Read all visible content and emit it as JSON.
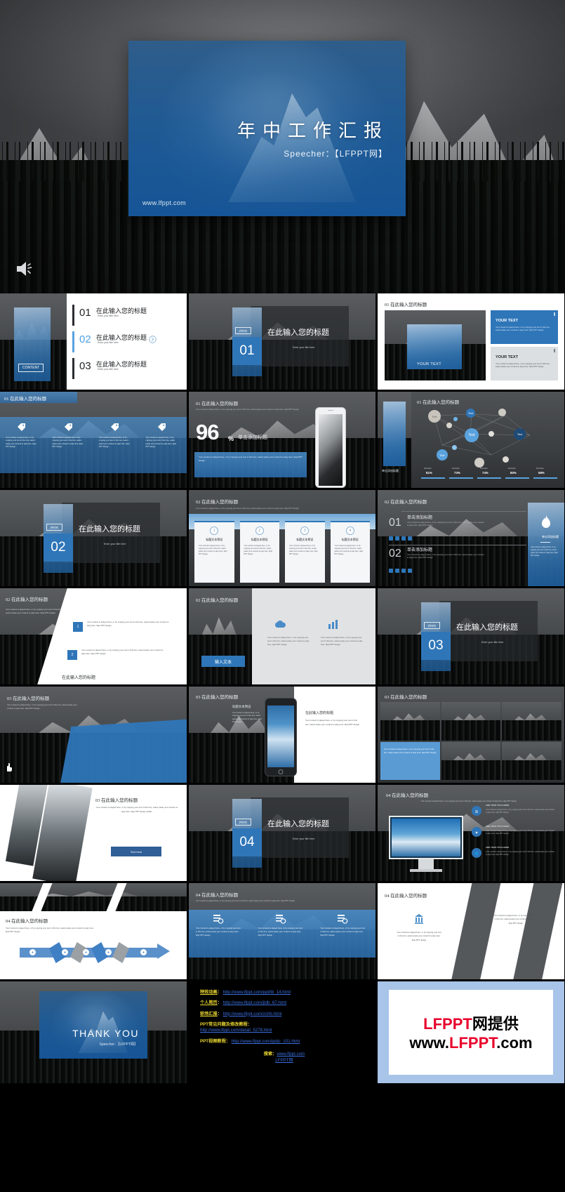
{
  "hero": {
    "title": "年中工作汇报",
    "speaker_label": "Speecher：",
    "speaker_value": "【LFPPT网】",
    "url": "www.lfppt.com",
    "sound_icon": "speaker-icon"
  },
  "common": {
    "title_cn": "在此输入您的标题",
    "subtitle_en": "Enter your title here",
    "body_en": "Your content is played here, or by copying your text in this box, select paste your content to play here. lfppt PPT design studio.",
    "body_en_short": "Your content is played here, or by copying your text in this box, select paste your content to play here. lfppt PPT design",
    "your_text": "YOUR TEXT",
    "text": "Text",
    "part_label": "PATR",
    "content_label": "CONTENT",
    "add_title_cn": "单击添加标题",
    "add_title_sub": "单击添加标题",
    "input_text_cn": "输入文本",
    "text_here_btn": "Text here",
    "text_here": "Text here",
    "preview_cn": "标题文本预设",
    "add_your_title": "ADD YOUR TITLE HERE"
  },
  "slides": {
    "toc": {
      "content_label": "CONTENT",
      "items": [
        {
          "num": "01",
          "cn": "在此输入您的标题",
          "en": "Enter your title here"
        },
        {
          "num": "02",
          "cn": "在此输入您的标题",
          "en": "Enter your title here"
        },
        {
          "num": "03",
          "cn": "在此输入您的标题",
          "en": "Enter your title here"
        }
      ]
    },
    "part01": {
      "part": "PATR",
      "num": "01",
      "cn": "在此输入您的标题",
      "en": "Enter your title here"
    },
    "part02": {
      "part": "PATR",
      "num": "02",
      "cn": "在此输入您的标题",
      "en": "Enter your title here"
    },
    "part03": {
      "part": "PATR",
      "num": "03",
      "cn": "在此输入您的标题",
      "en": "Enter your title here"
    },
    "part04": {
      "part": "PATR",
      "num": "04",
      "cn": "在此输入您的标题",
      "en": "Enter your title here"
    },
    "s_01_head": "01  在此输入您的标题",
    "s_02_head": "02  在此输入您的标题",
    "s_03_head": "03  在此输入您的标题",
    "s_04_head": "04  在此输入您的标题",
    "pct_slide": {
      "big_number": "96",
      "percent_sign": "%",
      "add_title": "单击添加标题"
    },
    "network": {
      "nodes": [
        "Text",
        "Text",
        "Text",
        "Text",
        "Text"
      ],
      "bars_labels": [
        "Text here",
        "Text here",
        "Text here",
        "Text here",
        "Text here"
      ],
      "bars_values": [
        "81%",
        "73%",
        "74%",
        "80%",
        "58%"
      ]
    },
    "steps": {
      "numbers": [
        "1",
        "2",
        "3",
        "4"
      ],
      "labels": [
        "标题文本预设",
        "标题文本预设",
        "标题文本预设",
        "标题文本预设"
      ]
    },
    "numbered": {
      "n1": "01",
      "n2": "02",
      "add_title": "单击添加标题"
    },
    "thank_you": {
      "title": "THANK YOU",
      "speaker_label": "Speecher：",
      "speaker_value": "【LFPPT网】"
    }
  },
  "links": {
    "rows": [
      {
        "label": "特效动画",
        "sep": "：",
        "url": "http://www.lfppt.com/ppt/tb_14.html"
      },
      {
        "label": "个人简历",
        "sep": "：",
        "url": "http://www.lfppt.com/jldb_67.html"
      },
      {
        "label": "职场汇报",
        "sep": "：",
        "url": "http://www.lfppt.com/zchb.html"
      }
    ],
    "faq_label": "PPT常见问题及修改教程：",
    "faq_url": "http://www.lfppt.com/detail_5278.html",
    "video_label": "PPT视频教程：",
    "video_url": "http://www.lfppt.com/pptjc_101.html",
    "search_label": "搜索：",
    "search_url": "www.lfppt.com",
    "search_site": "LFPPT网"
  },
  "logo": {
    "line1_red": "LFPPT",
    "line1_black": "网提供",
    "line2_a": "www.",
    "line2_red": "LFPPT",
    "line2_b": ".com"
  },
  "colors": {
    "accent_blue": "#2f76b8",
    "light_blue": "#5aa2de",
    "dark_bg": "#3c3f42",
    "link_blue": "#3b6fe0",
    "label_yellow": "#e8d531",
    "logo_red": "#e8002a"
  }
}
